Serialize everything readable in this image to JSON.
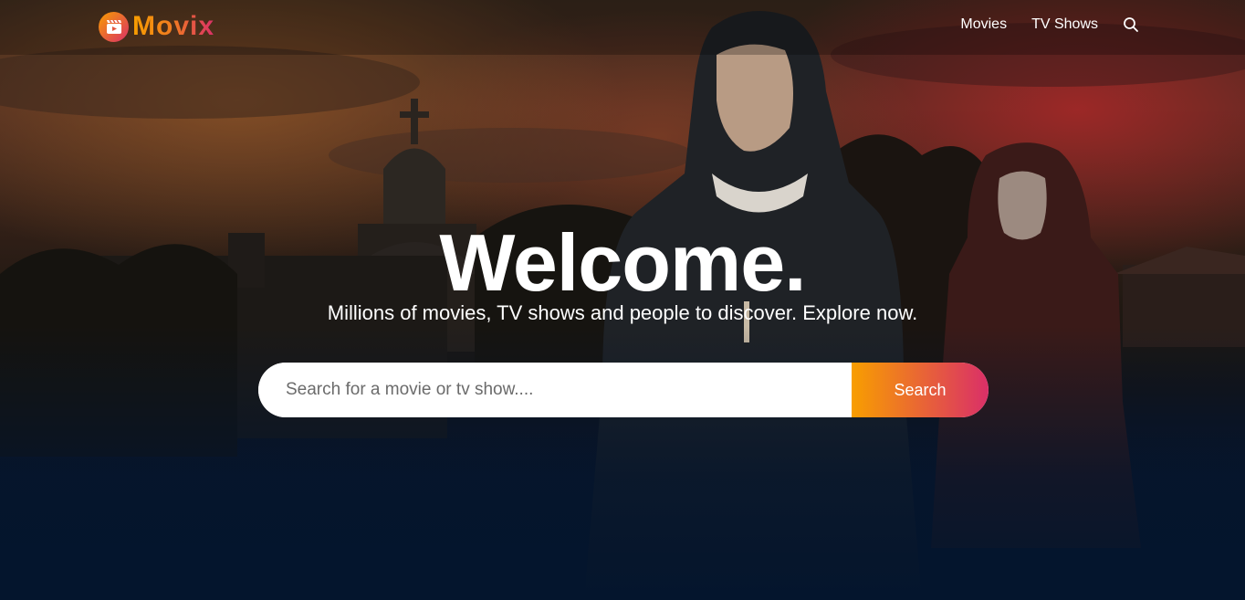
{
  "brand": {
    "name": "Movix",
    "icon": "film-clapper-icon",
    "gradient_start": "#f89e00",
    "gradient_end": "#da2f68"
  },
  "nav": {
    "items": [
      {
        "label": "Movies"
      },
      {
        "label": "TV Shows"
      }
    ],
    "search_icon": "search-icon"
  },
  "hero": {
    "title": "Welcome.",
    "subtitle": "Millions of movies, TV shows and people to discover. Explore now."
  },
  "search": {
    "placeholder": "Search for a movie or tv show....",
    "value": "",
    "button_label": "Search"
  },
  "colors": {
    "background": "#04152d",
    "text": "#ffffff"
  }
}
